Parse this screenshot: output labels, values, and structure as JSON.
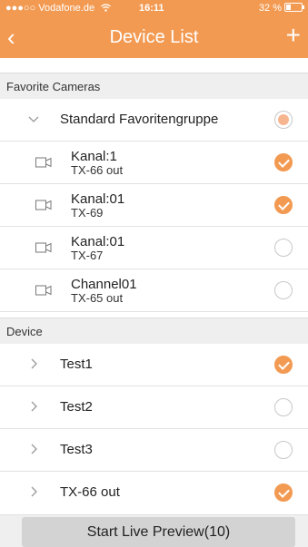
{
  "status": {
    "carrier": "●●●○○ Vodafone.de",
    "wifi_icon": "wifi-icon",
    "time": "16:11",
    "battery": "32 %"
  },
  "nav": {
    "title": "Device List",
    "back_glyph": "‹",
    "add_glyph": "+"
  },
  "favorites": {
    "header": "Favorite Cameras",
    "group": {
      "label": "Standard Favoritengruppe",
      "state": "partial"
    },
    "channels": [
      {
        "title": "Kanal:1",
        "subtitle": "TX-66 out",
        "checked": true
      },
      {
        "title": "Kanal:01",
        "subtitle": "TX-69",
        "checked": true
      },
      {
        "title": "Kanal:01",
        "subtitle": "TX-67",
        "checked": false
      },
      {
        "title": "Channel01",
        "subtitle": "TX-65 out",
        "checked": false
      }
    ]
  },
  "devices": {
    "header": "Device",
    "items": [
      {
        "label": "Test1",
        "checked": true
      },
      {
        "label": "Test2",
        "checked": false
      },
      {
        "label": "Test3",
        "checked": false
      },
      {
        "label": "TX-66 out",
        "checked": true
      }
    ]
  },
  "footer": {
    "button_label": "Start Live Preview(10)"
  },
  "colors": {
    "accent": "#f39a52",
    "section_bg": "#efefef",
    "button_bg": "#d3d3d3"
  }
}
